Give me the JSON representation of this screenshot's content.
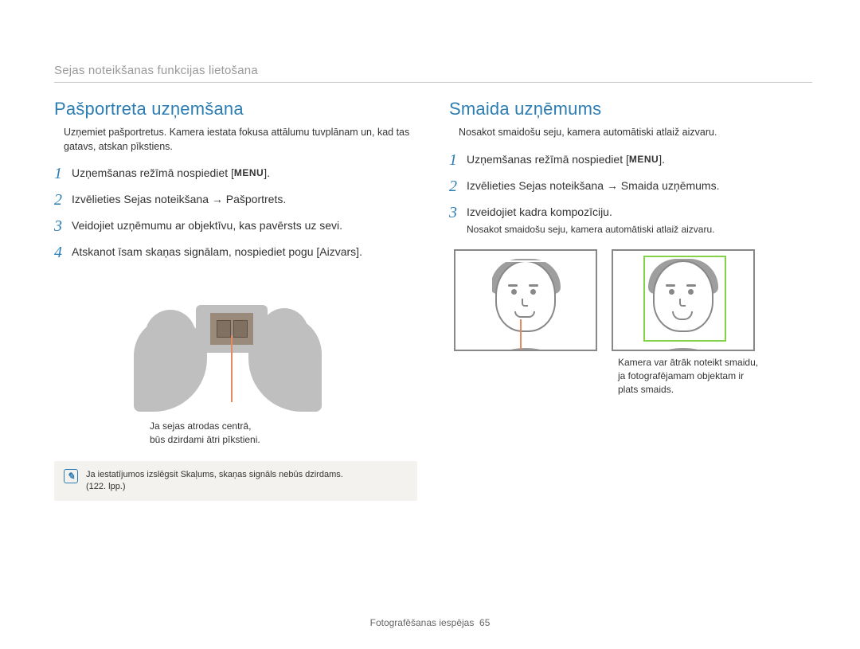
{
  "breadcrumb": "Sejas noteikšanas funkcijas lietošana",
  "left": {
    "title": "Pašportreta uzņemšana",
    "intro": "Uzņemiet pašportretus. Kamera iestata fokusa attālumu tuvplānam un, kad tas gatavs, atskan pīkstiens.",
    "steps": {
      "s1": {
        "num": "1",
        "pre": "Uzņemšanas režīmā nospiediet [",
        "menu": "MENU",
        "post": "]."
      },
      "s2": {
        "num": "2",
        "text": "Izvēlieties Sejas noteikšana → Pašportrets."
      },
      "s3": {
        "num": "3",
        "text": "Veidojiet uzņēmumu ar objektīvu, kas pavērsts uz sevi."
      },
      "s4": {
        "num": "4",
        "text": "Atskanot īsam skaņas signālam, nospiediet pogu [Aizvars]."
      }
    },
    "fig_caption_l1": "Ja sejas atrodas centrā,",
    "fig_caption_l2": "būs dzirdami ātri pīkstieni.",
    "note": {
      "line1": "Ja iestatījumos izslēgsit Skaļums, skaņas signāls nebūs dzirdams.",
      "line2": "(122. lpp.)"
    }
  },
  "right": {
    "title": "Smaida uzņēmums",
    "intro": "Nosakot smaidošu seju, kamera automātiski atlaiž aizvaru.",
    "steps": {
      "s1": {
        "num": "1",
        "pre": "Uzņemšanas režīmā nospiediet [",
        "menu": "MENU",
        "post": "]."
      },
      "s2": {
        "num": "2",
        "text": "Izvēlieties Sejas noteikšana → Smaida uzņēmums."
      },
      "s3": {
        "num": "3",
        "text": "Izveidojiet kadra kompozīciju.",
        "sub": "Nosakot smaidošu seju, kamera automātiski atlaiž aizvaru."
      }
    },
    "fig_caption_l1": "Kamera var ātrāk noteikt smaidu,",
    "fig_caption_l2": "ja fotografējamam objektam ir",
    "fig_caption_l3": "plats smaids."
  },
  "footer": {
    "section": "Fotografēšanas iespējas",
    "page": "65"
  }
}
